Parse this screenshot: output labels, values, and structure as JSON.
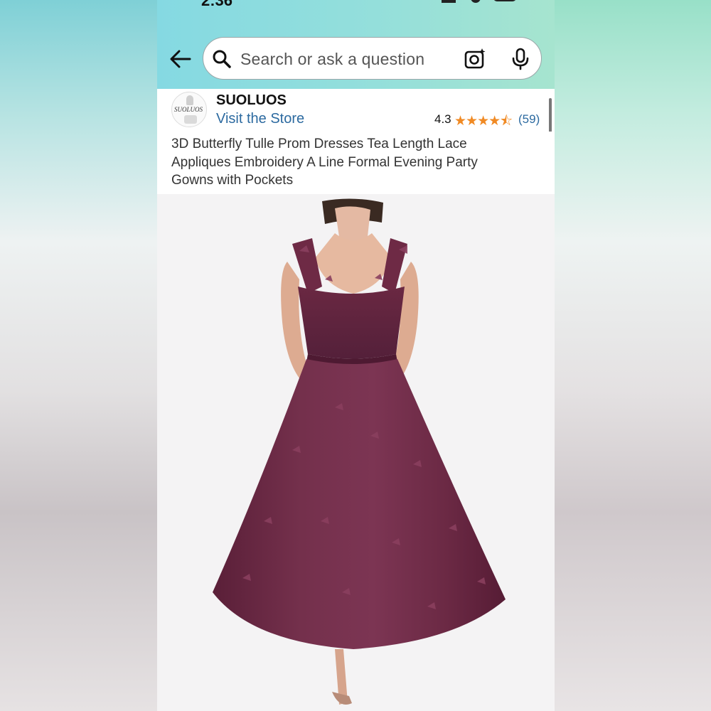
{
  "status": {
    "time": "2:36"
  },
  "search": {
    "placeholder": "Search or ask a question"
  },
  "store": {
    "logo_text": "SUOLUOS",
    "brand": "SUOLUOS",
    "visit_label": "Visit the Store",
    "rating": "4.3",
    "stars": "★★★★⯪",
    "rating_count": "(59)"
  },
  "product": {
    "title_lines": [
      "3D Butterfly Tulle Prom Dresses Tea Length Lace",
      "Appliques Embroidery A Line Formal Evening Party",
      "Gowns with Pockets"
    ]
  },
  "icons": {
    "back": "arrow-left-icon",
    "search": "search-icon",
    "camera": "camera-lens-icon",
    "mic": "microphone-icon"
  },
  "colors": {
    "link": "#2c6aa0",
    "star": "#f08a24",
    "dress": "#6e2a45",
    "header_left": "#85d9e2",
    "header_right": "#a6e4cf"
  }
}
